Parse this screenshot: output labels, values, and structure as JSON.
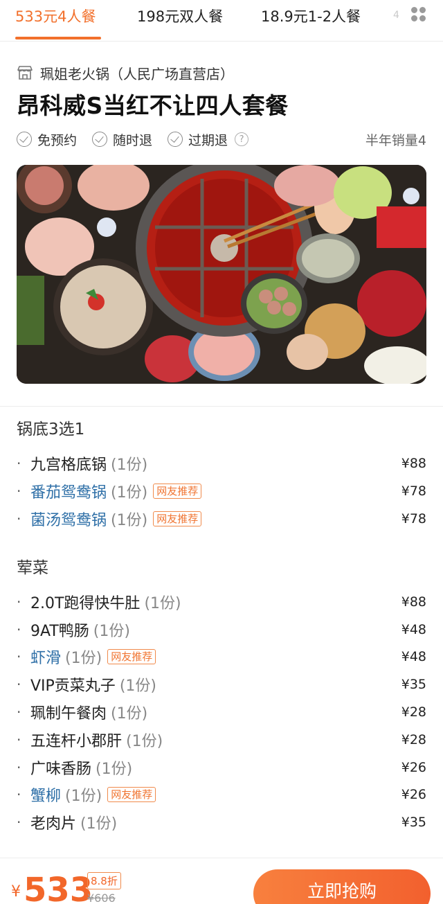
{
  "tabs": [
    {
      "label": "533元4人餐",
      "active": true
    },
    {
      "label": "198元双人餐",
      "active": false
    },
    {
      "label": "18.9元1-2人餐",
      "active": false
    }
  ],
  "tab_more": "4",
  "shop": {
    "name": "珮姐老火锅（人民广场直营店）"
  },
  "deal": {
    "title": "昂科威S当红不让四人套餐"
  },
  "features": [
    {
      "label": "免预约"
    },
    {
      "label": "随时退"
    },
    {
      "label": "过期退"
    }
  ],
  "help_glyph": "?",
  "sales": "半年销量4",
  "photo": {
    "icon": "hotpot-photo"
  },
  "item_dot": "·",
  "sections": [
    {
      "title": "锅底3选1",
      "items": [
        {
          "name": "九宫格底锅",
          "qty": "(1份)",
          "price": "¥88",
          "badge": ""
        },
        {
          "name": "番茄鸳鸯锅",
          "qty": "(1份)",
          "price": "¥78",
          "badge": "网友推荐"
        },
        {
          "name": "菌汤鸳鸯锅",
          "qty": "(1份)",
          "price": "¥78",
          "badge": "网友推荐"
        }
      ]
    },
    {
      "title": "荤菜",
      "items": [
        {
          "name": "2.0T跑得快牛肚",
          "qty": "(1份)",
          "price": "¥88",
          "badge": ""
        },
        {
          "name": "9AT鸭肠",
          "qty": "(1份)",
          "price": "¥48",
          "badge": ""
        },
        {
          "name": "虾滑",
          "qty": "(1份)",
          "price": "¥48",
          "badge": "网友推荐"
        },
        {
          "name": "VIP贡菜丸子",
          "qty": "(1份)",
          "price": "¥35",
          "badge": ""
        },
        {
          "name": "珮制午餐肉",
          "qty": "(1份)",
          "price": "¥28",
          "badge": ""
        },
        {
          "name": "五连杆小郡肝",
          "qty": "(1份)",
          "price": "¥28",
          "badge": ""
        },
        {
          "name": "广味香肠",
          "qty": "(1份)",
          "price": "¥26",
          "badge": ""
        },
        {
          "name": "蟹柳",
          "qty": "(1份)",
          "price": "¥26",
          "badge": "网友推荐"
        },
        {
          "name": "老肉片",
          "qty": "(1份)",
          "price": "¥35",
          "badge": ""
        }
      ]
    }
  ],
  "bottom": {
    "currency": "¥",
    "price": "533",
    "discount": "8.8折",
    "original_price": "¥606",
    "buy_label": "立即抢购"
  },
  "colors": {
    "accent": "#f2702c",
    "recommended_link": "#2e6fa7"
  }
}
